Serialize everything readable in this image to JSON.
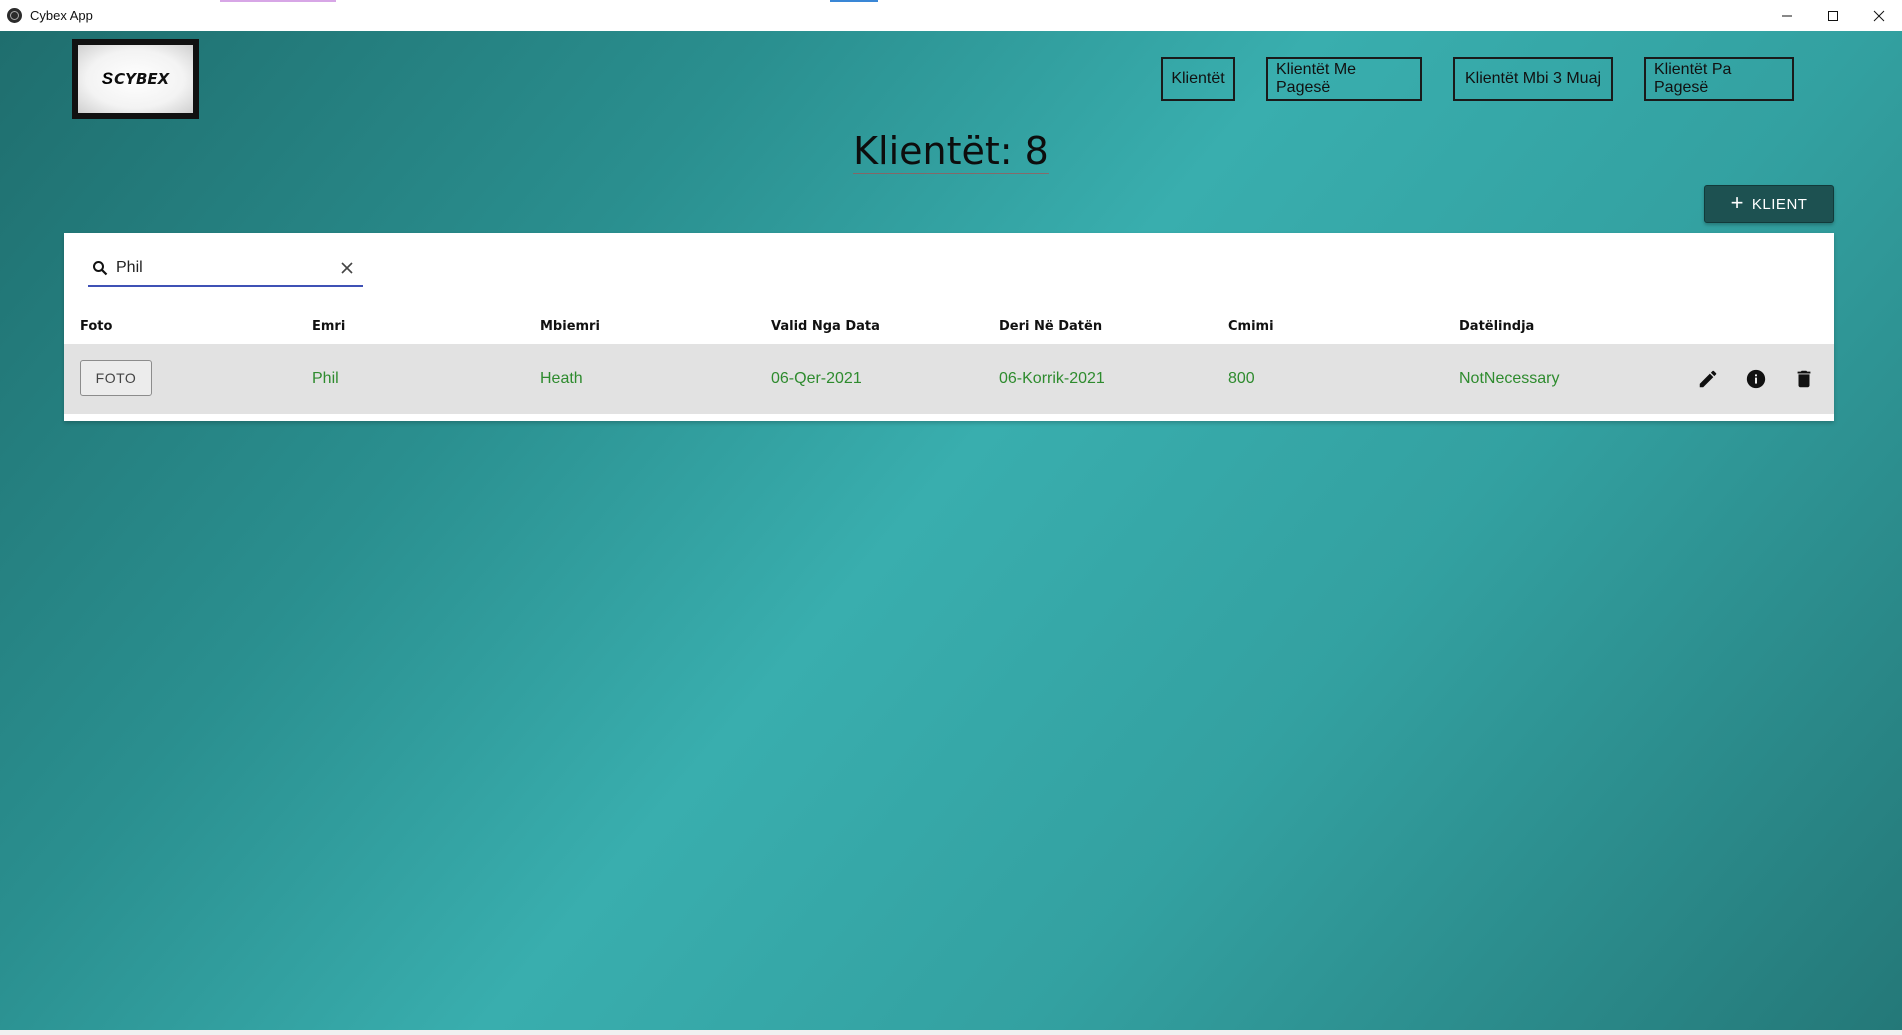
{
  "window": {
    "title": "Cybex App",
    "app_icon": "app-icon",
    "controls": [
      "minimize-icon",
      "maximize-icon",
      "close-icon"
    ]
  },
  "logo": {
    "text": "CYBEX"
  },
  "nav": [
    {
      "label": "Klientët"
    },
    {
      "label": "Klientët Me Pagesë"
    },
    {
      "label": "Klientët Mbi 3 Muaj"
    },
    {
      "label": "Klientët Pa Pagesë"
    }
  ],
  "page": {
    "title": "Klientët: 8"
  },
  "add_button": {
    "label": "KLIENT",
    "icon": "plus-icon"
  },
  "search": {
    "value": "Phil",
    "icon": "search-icon",
    "clear_icon": "close-icon"
  },
  "table": {
    "columns": [
      "Foto",
      "Emri",
      "Mbiemri",
      "Valid Nga Data",
      "Deri Në Datën",
      "Cmimi",
      "Datëlindja"
    ],
    "rows": [
      {
        "foto_label": "FOTO",
        "emri": "Phil",
        "mbiemri": "Heath",
        "valid_nga": "06-Qer-2021",
        "deri_ne": "06-Korrik-2021",
        "cmimi": "800",
        "datelindja": "NotNecessary"
      }
    ],
    "row_actions": [
      "edit-icon",
      "info-icon",
      "delete-icon"
    ]
  },
  "colors": {
    "bg_dark": "#1f6e6e",
    "bg_light": "#39aeae",
    "add_button": "#1d5151",
    "row_text": "#2e8b2e",
    "search_underline": "#3f51b5"
  }
}
